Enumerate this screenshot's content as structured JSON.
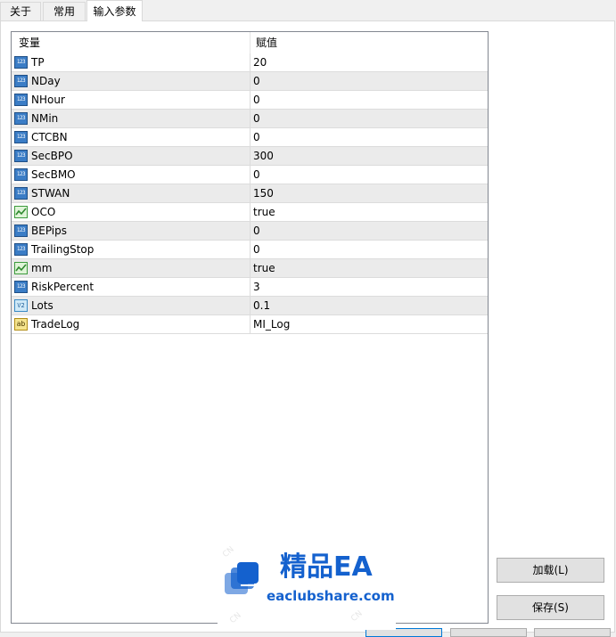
{
  "tabs": [
    {
      "label": "关于",
      "active": false
    },
    {
      "label": "常用",
      "active": false
    },
    {
      "label": "输入参数",
      "active": true
    }
  ],
  "table": {
    "columns": [
      "变量",
      "赋值"
    ],
    "rows": [
      {
        "icon": "int-type-icon",
        "name": "TP",
        "value": "20"
      },
      {
        "icon": "int-type-icon",
        "name": "NDay",
        "value": "0"
      },
      {
        "icon": "int-type-icon",
        "name": "NHour",
        "value": "0"
      },
      {
        "icon": "int-type-icon",
        "name": "NMin",
        "value": "0"
      },
      {
        "icon": "int-type-icon",
        "name": "CTCBN",
        "value": "0"
      },
      {
        "icon": "int-type-icon",
        "name": "SecBPO",
        "value": "300"
      },
      {
        "icon": "int-type-icon",
        "name": "SecBMO",
        "value": "0"
      },
      {
        "icon": "int-type-icon",
        "name": "STWAN",
        "value": "150"
      },
      {
        "icon": "bool-type-icon",
        "name": "OCO",
        "value": "true"
      },
      {
        "icon": "int-type-icon",
        "name": "BEPips",
        "value": "0"
      },
      {
        "icon": "int-type-icon",
        "name": "TrailingStop",
        "value": "0"
      },
      {
        "icon": "bool-type-icon",
        "name": "mm",
        "value": "true"
      },
      {
        "icon": "int-type-icon",
        "name": "RiskPercent",
        "value": "3"
      },
      {
        "icon": "double-type-icon",
        "name": "Lots",
        "value": "0.1"
      },
      {
        "icon": "string-type-icon",
        "name": "TradeLog",
        "value": " MI_Log"
      }
    ]
  },
  "icon_glyphs": {
    "int": "123",
    "double": "V2",
    "string": "ab"
  },
  "buttons": {
    "load": "加载(L)",
    "save": "保存(S)"
  },
  "watermark": {
    "title": "精品EA",
    "site": "eaclubshare.com"
  },
  "colors": {
    "accent": "#1461ce",
    "row_alt": "#ebebeb",
    "int_icon": "#3b7dc6",
    "bool_icon": "#3d9b3d",
    "string_icon": "#f5e48e"
  }
}
